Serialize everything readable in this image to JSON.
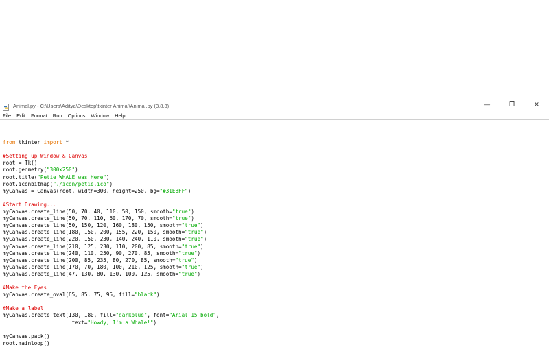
{
  "window": {
    "title": "Animal.py - C:\\Users\\Aditya\\Desktop\\tkinter Animal\\Animal.py (3.8.3)",
    "controls": {
      "minimize": "—",
      "restore": "❐",
      "close": "✕"
    }
  },
  "menu": {
    "items": [
      "File",
      "Edit",
      "Format",
      "Run",
      "Options",
      "Window",
      "Help"
    ]
  },
  "colors": {
    "keyword": "#e67300",
    "comment": "#dd0000",
    "string": "#00aa00",
    "text": "#000000"
  },
  "code": {
    "lines": [
      [],
      [
        {
          "t": "kw",
          "s": "from"
        },
        {
          "t": "tx",
          "s": " tkinter "
        },
        {
          "t": "kw",
          "s": "import"
        },
        {
          "t": "tx",
          "s": " *"
        }
      ],
      [],
      [
        {
          "t": "cm",
          "s": "#Setting up Window & Canvas"
        }
      ],
      [
        {
          "t": "tx",
          "s": "root = Tk()"
        }
      ],
      [
        {
          "t": "tx",
          "s": "root.geometry("
        },
        {
          "t": "st",
          "s": "\"300x250\""
        },
        {
          "t": "tx",
          "s": ")"
        }
      ],
      [
        {
          "t": "tx",
          "s": "root.title("
        },
        {
          "t": "st",
          "s": "\"Petie WHALE was Here\""
        },
        {
          "t": "tx",
          "s": ")"
        }
      ],
      [
        {
          "t": "tx",
          "s": "root.iconbitmap("
        },
        {
          "t": "st",
          "s": "\"./icon/petie.ico\""
        },
        {
          "t": "tx",
          "s": ")"
        }
      ],
      [
        {
          "t": "tx",
          "s": "myCanvas = Canvas(root, width=300, height=250, bg="
        },
        {
          "t": "st",
          "s": "\"#31E8FF\""
        },
        {
          "t": "tx",
          "s": ")"
        }
      ],
      [],
      [
        {
          "t": "cm",
          "s": "#Start Drawing..."
        }
      ],
      [
        {
          "t": "tx",
          "s": "myCanvas.create_line(50, 70, 40, 110, 50, 150, smooth="
        },
        {
          "t": "st",
          "s": "\"true\""
        },
        {
          "t": "tx",
          "s": ")"
        }
      ],
      [
        {
          "t": "tx",
          "s": "myCanvas.create_line(50, 70, 110, 60, 170, 70, smooth="
        },
        {
          "t": "st",
          "s": "\"true\""
        },
        {
          "t": "tx",
          "s": ")"
        }
      ],
      [
        {
          "t": "tx",
          "s": "myCanvas.create_line(50, 150, 120, 160, 180, 150, smooth="
        },
        {
          "t": "st",
          "s": "\"true\""
        },
        {
          "t": "tx",
          "s": ")"
        }
      ],
      [
        {
          "t": "tx",
          "s": "myCanvas.create_line(180, 150, 200, 155, 220, 150, smooth="
        },
        {
          "t": "st",
          "s": "\"true\""
        },
        {
          "t": "tx",
          "s": ")"
        }
      ],
      [
        {
          "t": "tx",
          "s": "myCanvas.create_line(220, 150, 230, 140, 240, 110, smooth="
        },
        {
          "t": "st",
          "s": "\"true\""
        },
        {
          "t": "tx",
          "s": ")"
        }
      ],
      [
        {
          "t": "tx",
          "s": "myCanvas.create_line(210, 125, 230, 110, 200, 85, smooth="
        },
        {
          "t": "st",
          "s": "\"true\""
        },
        {
          "t": "tx",
          "s": ")"
        }
      ],
      [
        {
          "t": "tx",
          "s": "myCanvas.create_line(240, 110, 250, 90, 270, 85, smooth="
        },
        {
          "t": "st",
          "s": "\"true\""
        },
        {
          "t": "tx",
          "s": ")"
        }
      ],
      [
        {
          "t": "tx",
          "s": "myCanvas.create_line(200, 85, 235, 80, 270, 85, smooth="
        },
        {
          "t": "st",
          "s": "\"true\""
        },
        {
          "t": "tx",
          "s": ")"
        }
      ],
      [
        {
          "t": "tx",
          "s": "myCanvas.create_line(170, 70, 180, 100, 210, 125, smooth="
        },
        {
          "t": "st",
          "s": "\"true\""
        },
        {
          "t": "tx",
          "s": ")"
        }
      ],
      [
        {
          "t": "tx",
          "s": "myCanvas.create_line(47, 130, 80, 130, 100, 125, smooth="
        },
        {
          "t": "st",
          "s": "\"true\""
        },
        {
          "t": "tx",
          "s": ")"
        }
      ],
      [],
      [
        {
          "t": "cm",
          "s": "#Make the Eyes"
        }
      ],
      [
        {
          "t": "tx",
          "s": "myCanvas.create_oval(65, 85, 75, 95, fill="
        },
        {
          "t": "st",
          "s": "\"black\""
        },
        {
          "t": "tx",
          "s": ")"
        }
      ],
      [],
      [
        {
          "t": "cm",
          "s": "#Make a label"
        }
      ],
      [
        {
          "t": "tx",
          "s": "myCanvas.create_text(130, 180, fill="
        },
        {
          "t": "st",
          "s": "\"darkblue\""
        },
        {
          "t": "tx",
          "s": ", font="
        },
        {
          "t": "st",
          "s": "\"Arial 15 bold\""
        },
        {
          "t": "tx",
          "s": ","
        }
      ],
      [
        {
          "t": "tx",
          "s": "                      text="
        },
        {
          "t": "st",
          "s": "\"Howdy, I'm a Whale!\""
        },
        {
          "t": "tx",
          "s": ")"
        }
      ],
      [],
      [
        {
          "t": "tx",
          "s": "myCanvas.pack()"
        }
      ],
      [
        {
          "t": "tx",
          "s": "root.mainloop()"
        }
      ]
    ]
  }
}
